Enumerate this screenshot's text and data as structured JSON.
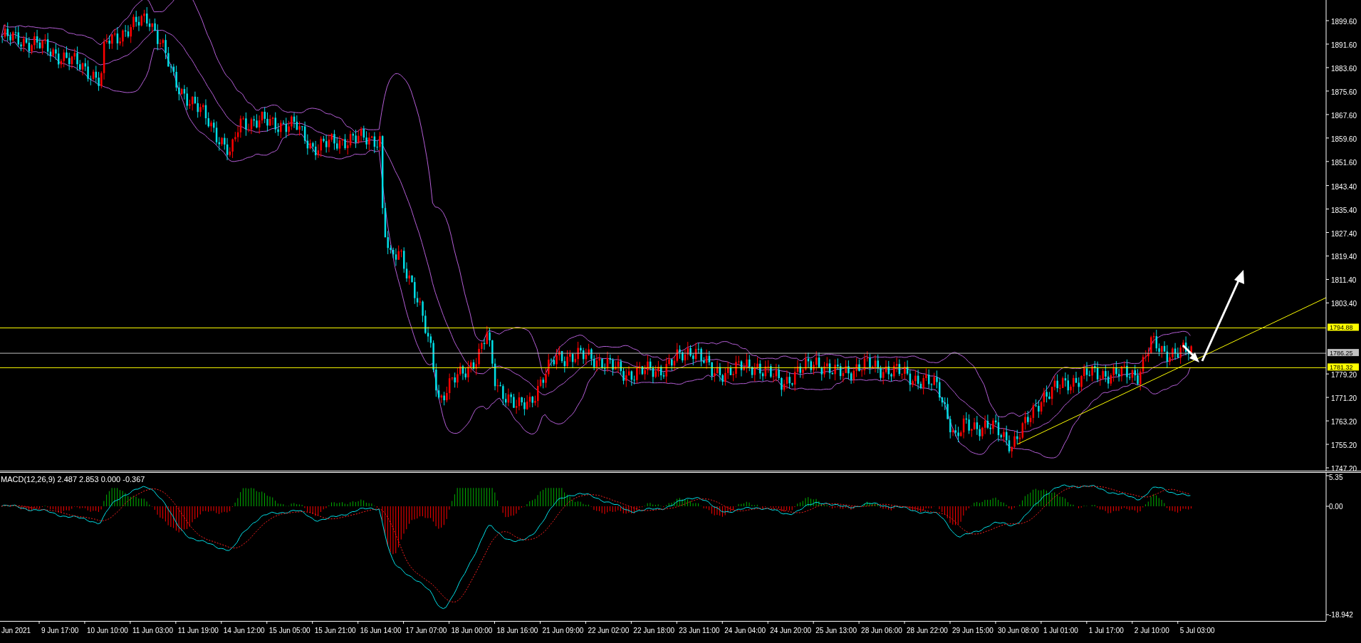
{
  "price_axis": {
    "ticks": [
      "1899.60",
      "1891.60",
      "1883.60",
      "1875.60",
      "1867.60",
      "1859.60",
      "1851.60",
      "1843.40",
      "1835.40",
      "1827.40",
      "1819.40",
      "1811.40",
      "1803.40",
      "1779.20",
      "1771.20",
      "1763.20",
      "1755.20",
      "1747.20"
    ]
  },
  "level_lines": [
    {
      "label": "1794.88",
      "color": "#ffff00"
    },
    {
      "label": "1786.25",
      "color": "#c0c0c0"
    },
    {
      "label": "1781.32",
      "color": "#ffff00"
    }
  ],
  "macd": {
    "title": "MACD(12,26,9) 2.487 2.853 0.000 -0.367",
    "axis_labels": [
      "5.35",
      "0.00",
      "-18.942"
    ]
  },
  "time_axis": [
    "Jun 2021",
    "9 Jun 17:00",
    "10 Jun 10:00",
    "11 Jun 03:00",
    "11 Jun 19:00",
    "14 Jun 12:00",
    "15 Jun 05:00",
    "15 Jun 21:00",
    "16 Jun 14:00",
    "17 Jun 07:00",
    "18 Jun 00:00",
    "18 Jun 16:00",
    "21 Jun 09:00",
    "22 Jun 02:00",
    "22 Jun 18:00",
    "23 Jun 11:00",
    "24 Jun 04:00",
    "24 Jun 20:00",
    "25 Jun 13:00",
    "28 Jun 06:00",
    "28 Jun 22:00",
    "29 Jun 15:00",
    "30 Jun 08:00",
    "1 Jul 01:00",
    "1 Jul 17:00",
    "2 Jul 10:00",
    "5 Jul 03:00"
  ]
}
